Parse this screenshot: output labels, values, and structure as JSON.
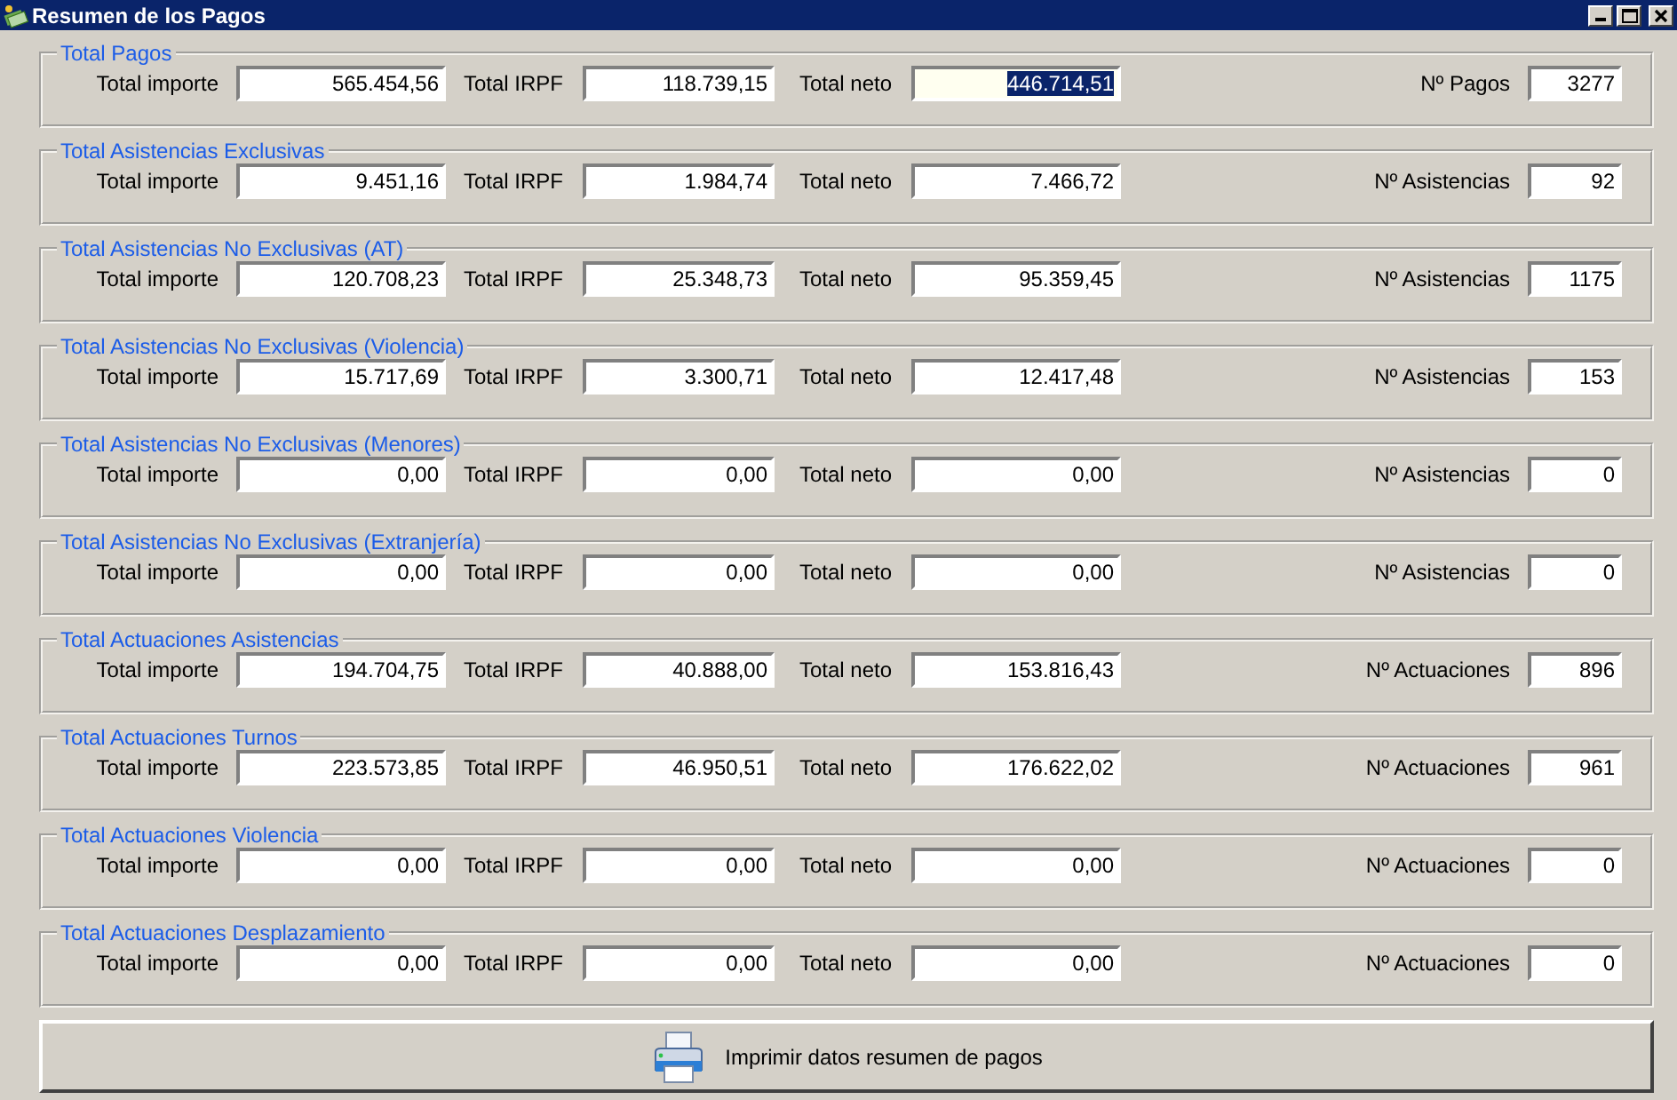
{
  "window": {
    "title": "Resumen de los Pagos"
  },
  "groups": [
    {
      "title": "Total Pagos",
      "fields": [
        {
          "label": "Total importe",
          "value": "565.454,56",
          "focused": false
        },
        {
          "label": "Total IRPF",
          "value": "118.739,15",
          "focused": false
        },
        {
          "label": "Total neto",
          "value": "446.714,51",
          "focused": true
        },
        {
          "label": "Nº Pagos",
          "value": "3277",
          "focused": false
        }
      ]
    },
    {
      "title": "Total Asistencias Exclusivas",
      "fields": [
        {
          "label": "Total importe",
          "value": "9.451,16",
          "focused": false
        },
        {
          "label": "Total IRPF",
          "value": "1.984,74",
          "focused": false
        },
        {
          "label": "Total neto",
          "value": "7.466,72",
          "focused": false
        },
        {
          "label": "Nº Asistencias",
          "value": "92",
          "focused": false
        }
      ]
    },
    {
      "title": "Total Asistencias No Exclusivas (AT)",
      "fields": [
        {
          "label": "Total importe",
          "value": "120.708,23",
          "focused": false
        },
        {
          "label": "Total IRPF",
          "value": "25.348,73",
          "focused": false
        },
        {
          "label": "Total neto",
          "value": "95.359,45",
          "focused": false
        },
        {
          "label": "Nº Asistencias",
          "value": "1175",
          "focused": false
        }
      ]
    },
    {
      "title": "Total Asistencias No Exclusivas (Violencia)",
      "fields": [
        {
          "label": "Total importe",
          "value": "15.717,69",
          "focused": false
        },
        {
          "label": "Total IRPF",
          "value": "3.300,71",
          "focused": false
        },
        {
          "label": "Total neto",
          "value": "12.417,48",
          "focused": false
        },
        {
          "label": "Nº Asistencias",
          "value": "153",
          "focused": false
        }
      ]
    },
    {
      "title": "Total Asistencias No Exclusivas (Menores)",
      "fields": [
        {
          "label": "Total importe",
          "value": "0,00",
          "focused": false
        },
        {
          "label": "Total IRPF",
          "value": "0,00",
          "focused": false
        },
        {
          "label": "Total neto",
          "value": "0,00",
          "focused": false
        },
        {
          "label": "Nº Asistencias",
          "value": "0",
          "focused": false
        }
      ]
    },
    {
      "title": "Total Asistencias No Exclusivas (Extranjería)",
      "fields": [
        {
          "label": "Total importe",
          "value": "0,00",
          "focused": false
        },
        {
          "label": "Total IRPF",
          "value": "0,00",
          "focused": false
        },
        {
          "label": "Total neto",
          "value": "0,00",
          "focused": false
        },
        {
          "label": "Nº Asistencias",
          "value": "0",
          "focused": false
        }
      ]
    },
    {
      "title": "Total Actuaciones Asistencias",
      "fields": [
        {
          "label": "Total importe",
          "value": "194.704,75",
          "focused": false
        },
        {
          "label": "Total IRPF",
          "value": "40.888,00",
          "focused": false
        },
        {
          "label": "Total neto",
          "value": "153.816,43",
          "focused": false
        },
        {
          "label": "Nº Actuaciones",
          "value": "896",
          "focused": false
        }
      ]
    },
    {
      "title": "Total Actuaciones Turnos",
      "fields": [
        {
          "label": "Total importe",
          "value": "223.573,85",
          "focused": false
        },
        {
          "label": "Total IRPF",
          "value": "46.950,51",
          "focused": false
        },
        {
          "label": "Total neto",
          "value": "176.622,02",
          "focused": false
        },
        {
          "label": "Nº Actuaciones",
          "value": "961",
          "focused": false
        }
      ]
    },
    {
      "title": "Total Actuaciones Violencia",
      "fields": [
        {
          "label": "Total importe",
          "value": "0,00",
          "focused": false
        },
        {
          "label": "Total IRPF",
          "value": "0,00",
          "focused": false
        },
        {
          "label": "Total neto",
          "value": "0,00",
          "focused": false
        },
        {
          "label": "Nº Actuaciones",
          "value": "0",
          "focused": false
        }
      ]
    },
    {
      "title": "Total Actuaciones Desplazamiento",
      "fields": [
        {
          "label": "Total importe",
          "value": "0,00",
          "focused": false
        },
        {
          "label": "Total IRPF",
          "value": "0,00",
          "focused": false
        },
        {
          "label": "Total neto",
          "value": "0,00",
          "focused": false
        },
        {
          "label": "Nº Actuaciones",
          "value": "0",
          "focused": false
        }
      ]
    }
  ],
  "print_button": {
    "label": "Imprimir datos resumen de pagos"
  }
}
